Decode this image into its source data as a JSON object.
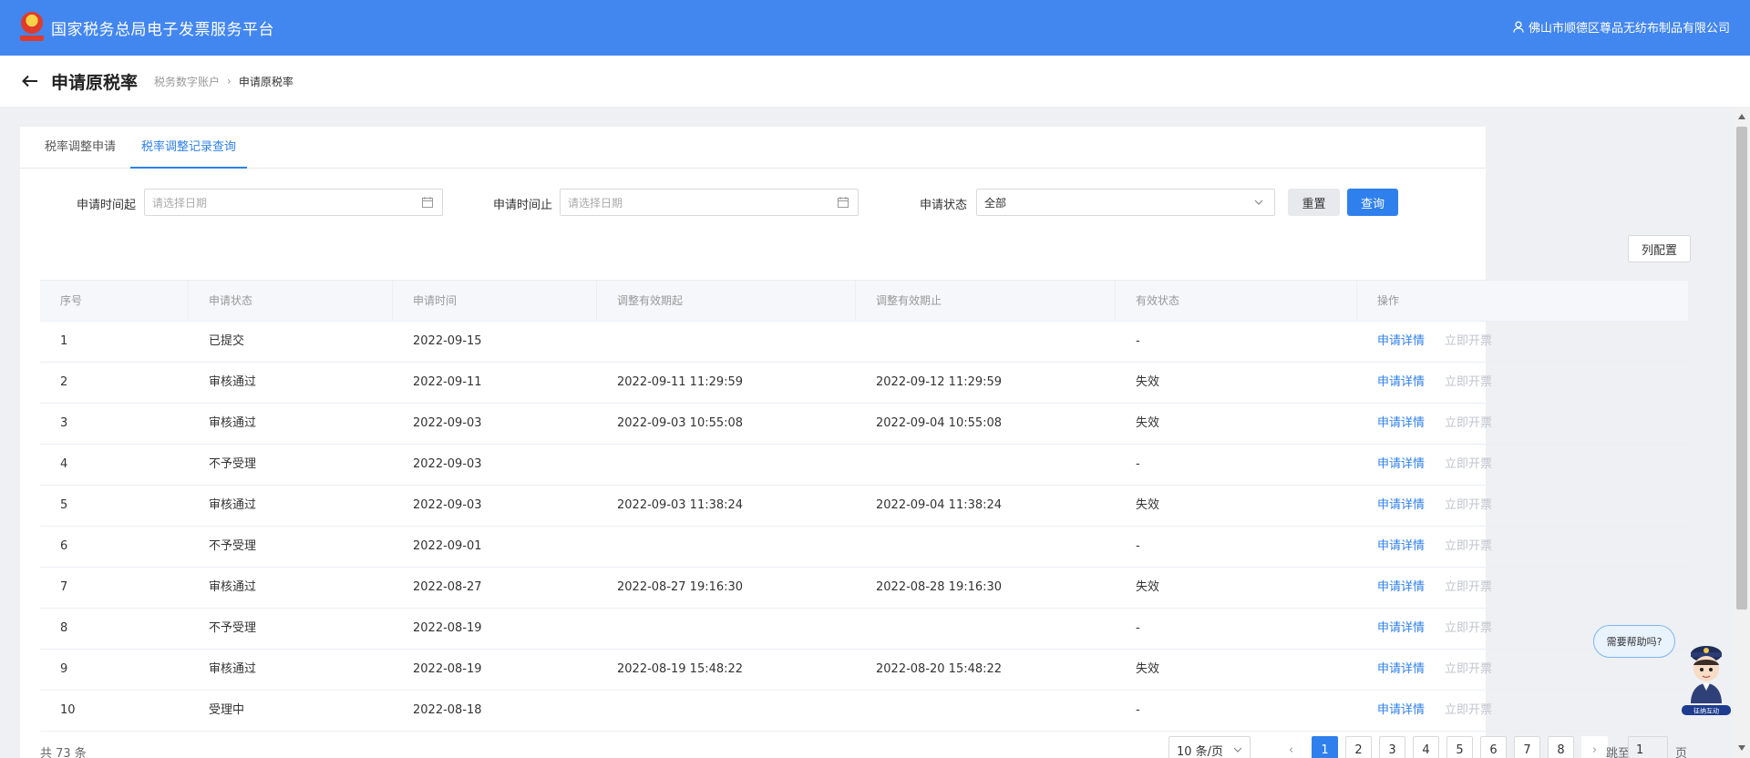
{
  "header": {
    "app_title": "国家税务总局电子发票服务平台",
    "user_company": "佛山市顺德区尊品无纺布制品有限公司"
  },
  "titlebar": {
    "page_title": "申请原税率",
    "breadcrumb": [
      "税务数字账户",
      "申请原税率"
    ]
  },
  "tabs": [
    {
      "label": "税率调整申请",
      "active": false
    },
    {
      "label": "税率调整记录查询",
      "active": true
    }
  ],
  "filters": {
    "start_label": "申请时间起",
    "start_placeholder": "请选择日期",
    "end_label": "申请时间止",
    "end_placeholder": "请选择日期",
    "status_label": "申请状态",
    "status_value": "全部",
    "reset_label": "重置",
    "query_label": "查询"
  },
  "column_config_label": "列配置",
  "table": {
    "columns": [
      "序号",
      "申请状态",
      "申请时间",
      "调整有效期起",
      "调整有效期止",
      "有效状态",
      "操作"
    ],
    "action_detail": "申请详情",
    "action_invoice": "立即开票",
    "rows": [
      [
        "1",
        "已提交",
        "2022-09-15",
        "",
        "",
        "-"
      ],
      [
        "2",
        "审核通过",
        "2022-09-11",
        "2022-09-11 11:29:59",
        "2022-09-12 11:29:59",
        "失效"
      ],
      [
        "3",
        "审核通过",
        "2022-09-03",
        "2022-09-03 10:55:08",
        "2022-09-04 10:55:08",
        "失效"
      ],
      [
        "4",
        "不予受理",
        "2022-09-03",
        "",
        "",
        "-"
      ],
      [
        "5",
        "审核通过",
        "2022-09-03",
        "2022-09-03 11:38:24",
        "2022-09-04 11:38:24",
        "失效"
      ],
      [
        "6",
        "不予受理",
        "2022-09-01",
        "",
        "",
        "-"
      ],
      [
        "7",
        "审核通过",
        "2022-08-27",
        "2022-08-27 19:16:30",
        "2022-08-28 19:16:30",
        "失效"
      ],
      [
        "8",
        "不予受理",
        "2022-08-19",
        "",
        "",
        "-"
      ],
      [
        "9",
        "审核通过",
        "2022-08-19",
        "2022-08-19 15:48:22",
        "2022-08-20 15:48:22",
        "失效"
      ],
      [
        "10",
        "受理中",
        "2022-08-18",
        "",
        "",
        "-"
      ]
    ]
  },
  "pagination": {
    "total_text": "共 73 条",
    "page_size": "10 条/页",
    "pages": [
      "1",
      "2",
      "3",
      "4",
      "5",
      "6",
      "7",
      "8"
    ],
    "current_page": "1",
    "jump_label": "跳至",
    "jump_value": "1",
    "jump_suffix": "页"
  },
  "help": {
    "bubble_text": "需要帮助吗?",
    "bot_label": "征纳互动"
  },
  "colors": {
    "header_blue": "#4286f0",
    "link_blue": "#2f80ed",
    "disabled_gray": "#c0c4cc"
  }
}
